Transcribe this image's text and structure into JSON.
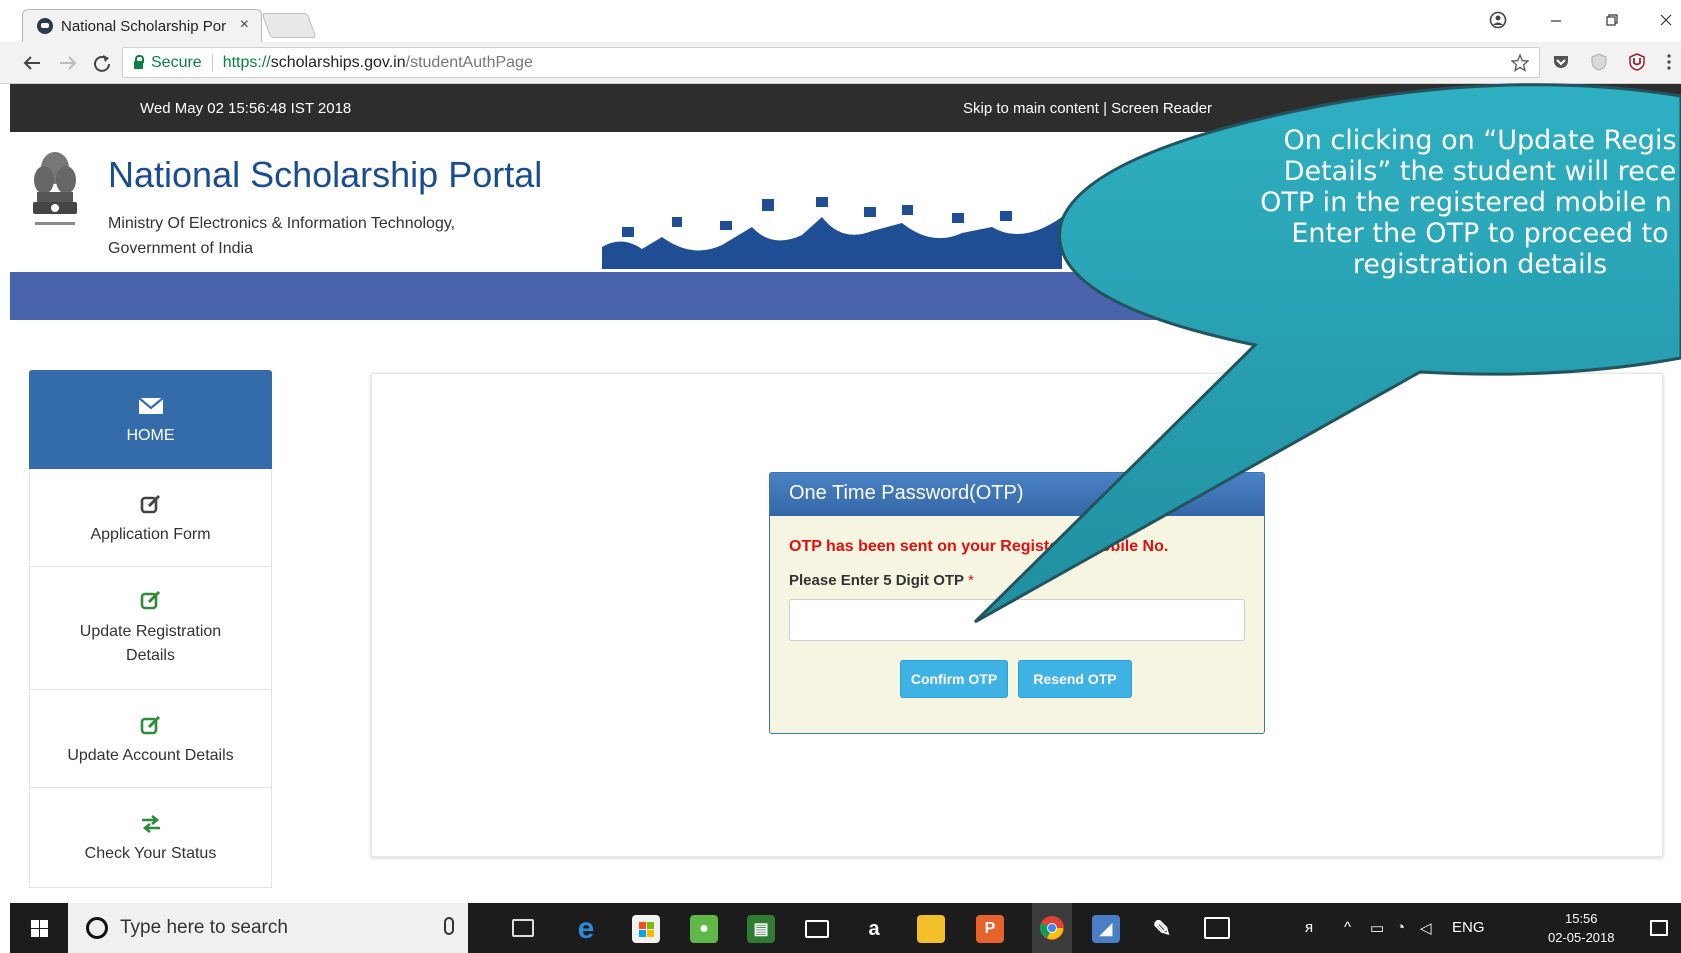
{
  "browser": {
    "tab_title": "National Scholarship Por",
    "tab_close": "×",
    "secure_label": "Secure",
    "url_scheme": "https://",
    "url_host": "scholarships.gov.in",
    "url_path": "/studentAuthPage"
  },
  "site": {
    "datetime": "Wed May 02 15:56:48 IST 2018",
    "skip_links": "Skip to main content | Screen Reader",
    "title": "National Scholarship Portal",
    "ministry_line1": "Ministry Of Electronics & Information Technology,",
    "ministry_line2": "Government of India",
    "colors": {
      "header_blue": "#4a63ad",
      "title_blue": "#1a4d8f",
      "sidebar_active": "#336bab",
      "button": "#3fb3e4",
      "callout": "#29a0b1"
    }
  },
  "sidebar": {
    "items": [
      {
        "label": "HOME",
        "icon": "envelope-icon"
      },
      {
        "label": "Application Form",
        "icon": "edit-icon"
      },
      {
        "label": "Update Registration",
        "label2": "Details",
        "icon": "edit-icon"
      },
      {
        "label": "Update Account Details",
        "icon": "edit-icon"
      },
      {
        "label": "Check Your Status",
        "icon": "exchange-icon"
      }
    ]
  },
  "otp": {
    "heading": "One Time Password(OTP)",
    "message": "OTP has been sent on your Registered Mobile No.",
    "field_label": "Please Enter 5 Digit OTP",
    "required_mark": "*",
    "input_value": "",
    "confirm_label": "Confirm OTP",
    "resend_label": "Resend OTP"
  },
  "callout": {
    "line1": "On clicking on “Update Regis",
    "line2": "Details” the student will rece",
    "line3": "OTP in the registered mobile n",
    "line4": "Enter the OTP to proceed to",
    "line5": "registration details"
  },
  "taskbar": {
    "search_placeholder": "Type here to search",
    "language": "ENG",
    "time": "15:56",
    "date": "02-05-2018"
  }
}
